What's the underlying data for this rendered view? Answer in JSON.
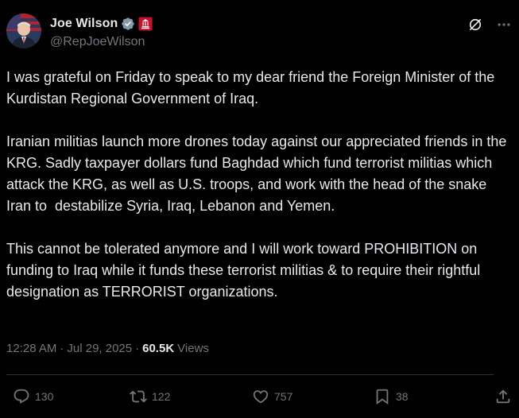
{
  "author": {
    "display_name": "Joe Wilson",
    "handle": "@RepJoeWilson",
    "avatar_icon": "profile-photo",
    "verified_icon": "verified-badge-icon",
    "affiliation_icon": "house-seal-icon"
  },
  "post": {
    "text": "I was grateful on Friday to speak to my dear friend the Foreign Minister of the Kurdistan Regional Government of Iraq.\n\nIranian militias launch more drones today against our appreciated friends in the KRG. Sadly taxpayer dollars fund Baghdad which fund terrorist militias which attack the KRG, as well as U.S. troops, and work with the head of the snake Iran to  destabilize Syria, Iraq, Lebanon and Yemen.\n\nThis cannot be tolerated anymore and I will work toward PROHIBITION on funding to Iraq while it funds these terrorist militias & to require their rightful designation as TERRORIST organizations.",
    "time": "12:28 AM",
    "separator": "·",
    "date": "Jul 29, 2025",
    "views_count": "60.5K",
    "views_label": "Views"
  },
  "actions": {
    "replies": "130",
    "reposts": "122",
    "likes": "757",
    "bookmarks": "38"
  },
  "colors": {
    "background": "#000000",
    "text_primary": "#e7e9ea",
    "text_secondary": "#71767b",
    "divider": "#2f3336",
    "verified_badge": "#829aab",
    "affiliation_badge": "#c8102e"
  }
}
